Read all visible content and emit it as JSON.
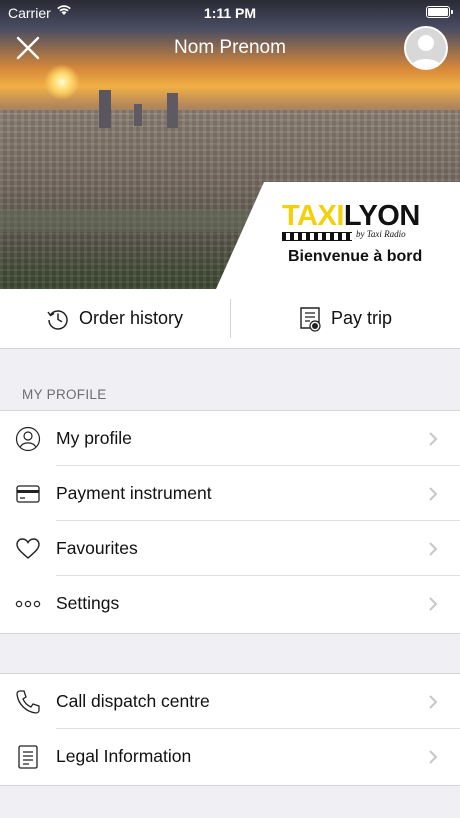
{
  "status_bar": {
    "carrier": "Carrier",
    "time": "1:11 PM"
  },
  "header": {
    "title": "Nom Prenom"
  },
  "logo": {
    "brand_taxi": "TAXI",
    "brand_lyon": "LYON",
    "by_line": "by Taxi Radio",
    "welcome": "Bienvenue à bord"
  },
  "actions": {
    "order_history": "Order history",
    "pay_trip": "Pay trip"
  },
  "profile_section": {
    "header": "MY PROFILE",
    "items": [
      {
        "label": "My profile",
        "icon": "user-icon"
      },
      {
        "label": "Payment instrument",
        "icon": "card-icon"
      },
      {
        "label": "Favourites",
        "icon": "heart-icon"
      },
      {
        "label": "Settings",
        "icon": "more-dots-icon"
      }
    ]
  },
  "support_section": {
    "items": [
      {
        "label": "Call dispatch centre",
        "icon": "phone-icon"
      },
      {
        "label": "Legal Information",
        "icon": "document-icon"
      }
    ]
  },
  "colors": {
    "accent_yellow": "#f2d00a",
    "background": "#efeff4",
    "text": "#111111",
    "chevron": "#c7c7cc"
  }
}
